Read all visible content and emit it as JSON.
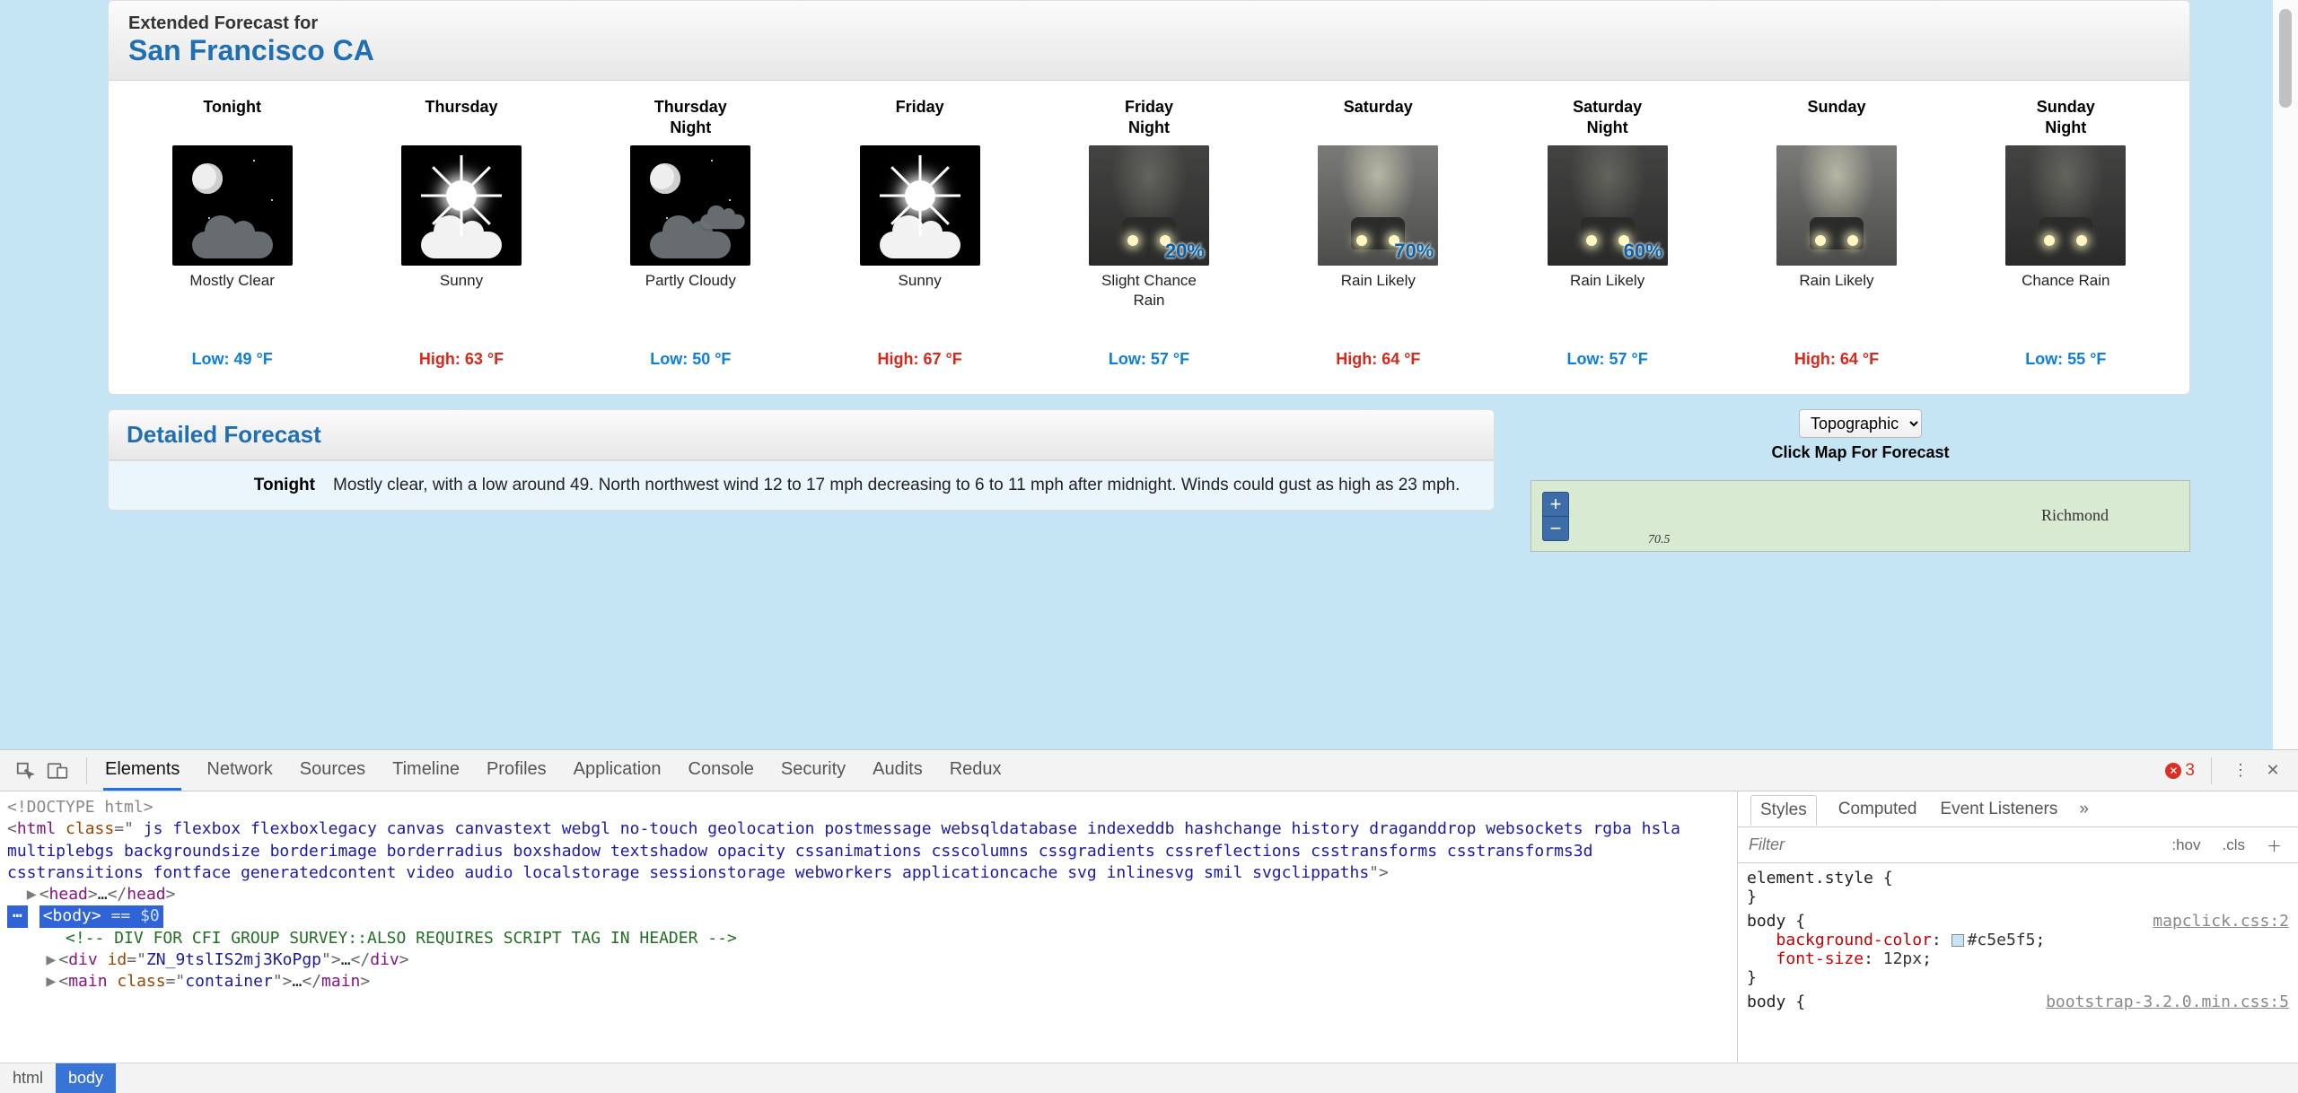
{
  "forecast": {
    "heading_sub": "Extended Forecast for",
    "city": "San Francisco CA",
    "days": [
      {
        "label": "Tonight",
        "kind": "night-clear",
        "cond": "Mostly Clear",
        "temp_kind": "low",
        "temp": "Low: 49 °F",
        "pct": ""
      },
      {
        "label": "Thursday",
        "kind": "day-sunny",
        "cond": "Sunny",
        "temp_kind": "high",
        "temp": "High: 63 °F",
        "pct": ""
      },
      {
        "label": "Thursday\nNight",
        "kind": "night-partly",
        "cond": "Partly Cloudy",
        "temp_kind": "low",
        "temp": "Low: 50 °F",
        "pct": ""
      },
      {
        "label": "Friday",
        "kind": "day-sunny",
        "cond": "Sunny",
        "temp_kind": "high",
        "temp": "High: 67 °F",
        "pct": ""
      },
      {
        "label": "Friday\nNight",
        "kind": "rain-night",
        "cond": "Slight Chance\nRain",
        "temp_kind": "low",
        "temp": "Low: 57 °F",
        "pct": "20%"
      },
      {
        "label": "Saturday",
        "kind": "rain-day",
        "cond": "Rain Likely",
        "temp_kind": "high",
        "temp": "High: 64 °F",
        "pct": "70%"
      },
      {
        "label": "Saturday\nNight",
        "kind": "rain-night",
        "cond": "Rain Likely",
        "temp_kind": "low",
        "temp": "Low: 57 °F",
        "pct": "60%"
      },
      {
        "label": "Sunday",
        "kind": "rain-day",
        "cond": "Rain Likely",
        "temp_kind": "high",
        "temp": "High: 64 °F",
        "pct": ""
      },
      {
        "label": "Sunday\nNight",
        "kind": "rain-night",
        "cond": "Chance Rain",
        "temp_kind": "low",
        "temp": "Low: 55 °F",
        "pct": ""
      }
    ]
  },
  "detailed": {
    "title": "Detailed Forecast",
    "row_k": "Tonight",
    "row_v": "Mostly clear, with a low around 49. North northwest wind 12 to 17 mph decreasing to 6 to 11 mph after midnight. Winds could gust as high as 23 mph."
  },
  "sidebar": {
    "select_value": "Topographic",
    "caption": "Click Map For Forecast",
    "map_city": "Richmond",
    "map_contour": "70.5"
  },
  "devtools": {
    "tabs": [
      "Elements",
      "Network",
      "Sources",
      "Timeline",
      "Profiles",
      "Application",
      "Console",
      "Security",
      "Audits",
      "Redux"
    ],
    "active_tab": "Elements",
    "error_count": "3",
    "styles_tabs": [
      "Styles",
      "Computed",
      "Event Listeners"
    ],
    "styles_active": "Styles",
    "filter_placeholder": "Filter",
    "hov_label": ":hov",
    "cls_label": ".cls",
    "crumbs": [
      "html",
      "body"
    ],
    "crumb_sel": "body",
    "dom": {
      "doctype": "<!DOCTYPE html>",
      "html_open": {
        "tag": "html",
        "attr": "class",
        "val": " js flexbox flexboxlegacy canvas canvastext webgl no-touch geolocation postmessage websqldatabase indexeddb hashchange history draganddrop websockets rgba hsla multiplebgs backgroundsize borderimage borderradius boxshadow textshadow opacity cssanimations csscolumns cssgradients cssreflections csstransforms csstransforms3d csstransitions fontface generatedcontent video audio localstorage sessionstorage webworkers applicationcache svg inlinesvg smil svgclippaths"
      },
      "head_line": "<head>…</head>",
      "body_sel": "<body>",
      "eq_text": " == $0",
      "comment": "<!-- DIV FOR CFI GROUP SURVEY::ALSO REQUIRES SCRIPT TAG IN HEADER -->",
      "div_id": "ZN_9tslIS2mj3KoPgp",
      "main_class": "container"
    },
    "rules": {
      "elstyle_sel": "element.style",
      "body_sel": "body",
      "body_src": "mapclick.css:2",
      "bgcolor_prop": "background-color",
      "bgcolor_val": "#c5e5f5",
      "fontsize_prop": "font-size",
      "fontsize_val": "12px",
      "body2_sel": "body",
      "body2_src": "bootstrap-3.2.0.min.css:5"
    }
  }
}
